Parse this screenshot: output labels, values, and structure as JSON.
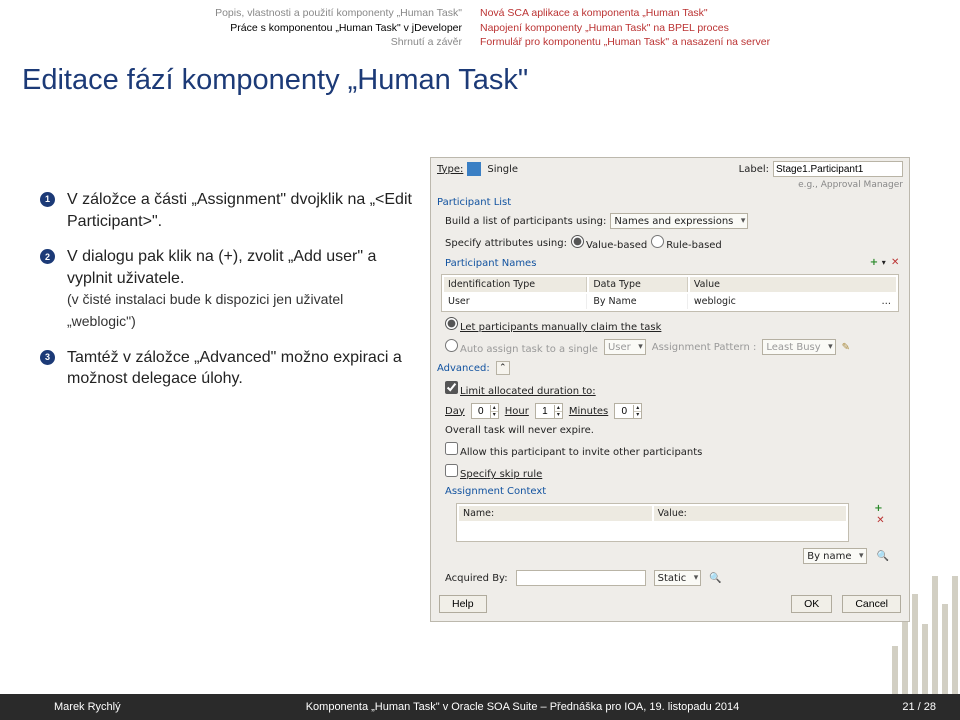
{
  "header": {
    "left": [
      "Popis, vlastnosti a použití komponenty „Human Task\"",
      "Práce s komponentou „Human Task\" v jDeveloper",
      "Shrnutí a závěr"
    ],
    "left_active_index": 1,
    "right": [
      "Nová SCA aplikace a komponenta „Human Task\"",
      "Napojení komponenty „Human Task\" na BPEL proces",
      "Formulář pro komponentu „Human Task\" a nasazení na server"
    ]
  },
  "title": "Editace fází komponenty „Human Task\"",
  "steps": [
    {
      "num": "1",
      "text": "V záložce a části „Assignment\" dvojklik na „<Edit Participant>\"."
    },
    {
      "num": "2",
      "text": "V dialogu pak klik na (+), zvolit „Add user\" a vyplnit uživatele.",
      "sub": "(v čisté instalaci bude k dispozici jen uživatel „weblogic\")"
    },
    {
      "num": "3",
      "text": "Tamtéž v záložce „Advanced\" možno expiraci a možnost delegace úlohy."
    }
  ],
  "dlg": {
    "type_label": "Type:",
    "type_value": "Single",
    "label_label": "Label:",
    "label_value": "Stage1.Participant1",
    "eg": "e.g., Approval Manager",
    "participant_list": "Participant List",
    "build_label": "Build a list of participants using:",
    "build_value": "Names and expressions",
    "specify_label": "Specify attributes using:",
    "radio_value": "Value-based",
    "radio_rule": "Rule-based",
    "participant_names": "Participant Names",
    "tbl": {
      "cols": [
        "Identification Type",
        "Data Type",
        "Value"
      ],
      "row": [
        "User",
        "By Name",
        "weblogic"
      ]
    },
    "let_manual": "Let participants manually claim the task",
    "auto_assign": "Auto assign task to a single",
    "auto_user": "User",
    "assign_pattern_label": "Assignment Pattern :",
    "assign_pattern_value": "Least Busy",
    "advanced": "Advanced:",
    "limit": "Limit allocated duration to:",
    "day_label": "Day",
    "day": "0",
    "hour_label": "Hour",
    "hour": "1",
    "min_label": "Minutes",
    "min": "0",
    "never_expire": "Overall task will never expire.",
    "allow_invite": "Allow this participant to invite other participants",
    "specify_skip": "Specify skip rule",
    "assign_ctx": "Assignment Context",
    "name_col": "Name:",
    "value_col": "Value:",
    "by_name": "By name",
    "acquired_by": "Acquired By:",
    "acquired_val": "Static",
    "help": "Help",
    "ok": "OK",
    "cancel": "Cancel"
  },
  "footer": {
    "author": "Marek Rychlý",
    "mid": "Komponenta „Human Task\" v Oracle SOA Suite – Přednáška pro IOA, 19. listopadu 2014",
    "page": "21 / 28"
  }
}
